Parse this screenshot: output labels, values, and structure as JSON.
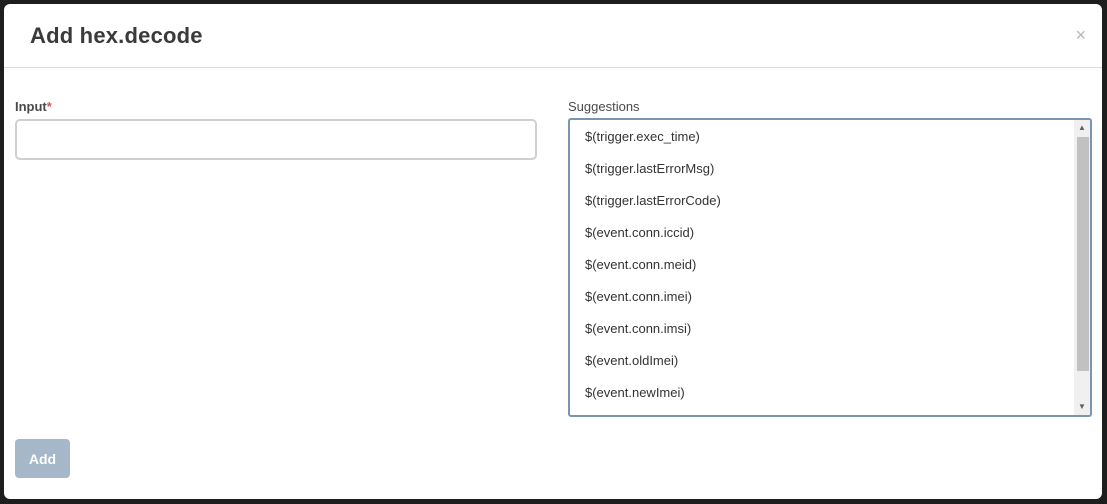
{
  "modal": {
    "title": "Add hex.decode",
    "close_glyph": "×"
  },
  "form": {
    "input_label": "Input",
    "required_marker": "*",
    "input_value": "",
    "suggestions_label": "Suggestions",
    "suggestions": [
      "$(trigger.exec_time)",
      "$(trigger.lastErrorMsg)",
      "$(trigger.lastErrorCode)",
      "$(event.conn.iccid)",
      "$(event.conn.meid)",
      "$(event.conn.imei)",
      "$(event.conn.imsi)",
      "$(event.oldImei)",
      "$(event.newImei)"
    ],
    "scroll_up_glyph": "▲",
    "scroll_down_glyph": "▼"
  },
  "actions": {
    "add_label": "Add"
  },
  "colors": {
    "add_button_disabled": "#a6b7c9",
    "required_star": "#d9534f",
    "suggest_border_focus": "#7a95b0"
  }
}
